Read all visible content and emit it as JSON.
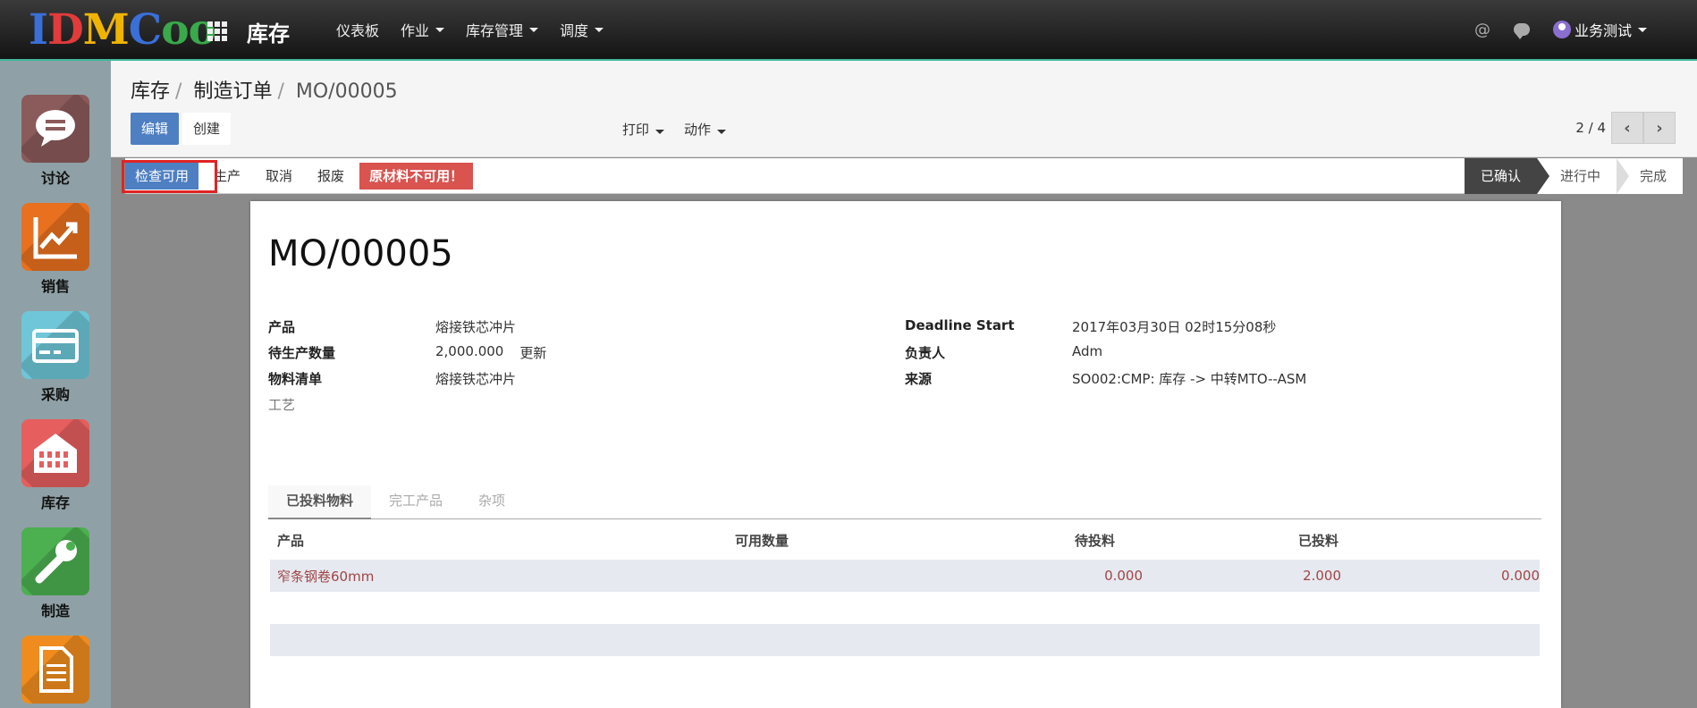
{
  "topbar": {
    "logo": [
      "I",
      "D",
      "M",
      "C",
      "o",
      "o"
    ],
    "app_title": "库存",
    "menu": [
      {
        "label": "仪表板",
        "dropdown": false
      },
      {
        "label": "作业",
        "dropdown": true
      },
      {
        "label": "库存管理",
        "dropdown": true
      },
      {
        "label": "调度",
        "dropdown": true
      }
    ],
    "at_symbol": "@",
    "user_name": "业务测试"
  },
  "sidebar": {
    "apps": [
      {
        "label": "讨论",
        "color": "#8b5a5a",
        "icon": "chat-bubble-icon"
      },
      {
        "label": "销售",
        "color": "#e8701f",
        "icon": "chart-line-icon"
      },
      {
        "label": "采购",
        "color": "#6ec6d8",
        "icon": "credit-card-icon"
      },
      {
        "label": "库存",
        "color": "#e65e5e",
        "icon": "warehouse-icon"
      },
      {
        "label": "制造",
        "color": "#4caf50",
        "icon": "wrench-icon"
      },
      {
        "label": "",
        "color": "#f08c1e",
        "icon": "document-icon"
      }
    ]
  },
  "breadcrumb": {
    "items": [
      "库存",
      "制造订单"
    ],
    "current": "MO/00005"
  },
  "toolbar": {
    "edit_label": "编辑",
    "create_label": "创建",
    "print_label": "打印",
    "action_label": "动作",
    "pager": "2 / 4"
  },
  "statusbar": {
    "buttons": {
      "check_availability": "检查可用",
      "produce": "生产",
      "cancel": "取消",
      "scrap": "报废",
      "unavailable": "原材料不可用！"
    },
    "stages": {
      "confirmed": "已确认",
      "in_progress": "进行中",
      "done": "完成"
    }
  },
  "form": {
    "title": "MO/00005",
    "left": {
      "product": {
        "label": "产品",
        "value": "熔接铁芯冲片"
      },
      "qty": {
        "label": "待生产数量",
        "value": "2,000.000",
        "update": "更新"
      },
      "bom": {
        "label": "物料清单",
        "value": "熔接铁芯冲片"
      },
      "routing": {
        "label": "工艺"
      }
    },
    "right": {
      "deadline": {
        "label": "Deadline Start",
        "value": "2017年03月30日 02时15分08秒"
      },
      "responsible": {
        "label": "负责人",
        "value": "Adm"
      },
      "source": {
        "label": "来源",
        "value": "SO002:CMP: 库存 -> 中转MTO--ASM"
      }
    }
  },
  "tabs": [
    "已投料物料",
    "完工产品",
    "杂项"
  ],
  "table": {
    "headers": {
      "product": "产品",
      "available": "可用数量",
      "to_consume": "待投料",
      "consumed": "已投料"
    },
    "rows": [
      {
        "product": "窄条钢卷60mm",
        "available": "0.000",
        "to_consume": "2.000",
        "consumed": "0.000"
      }
    ]
  }
}
